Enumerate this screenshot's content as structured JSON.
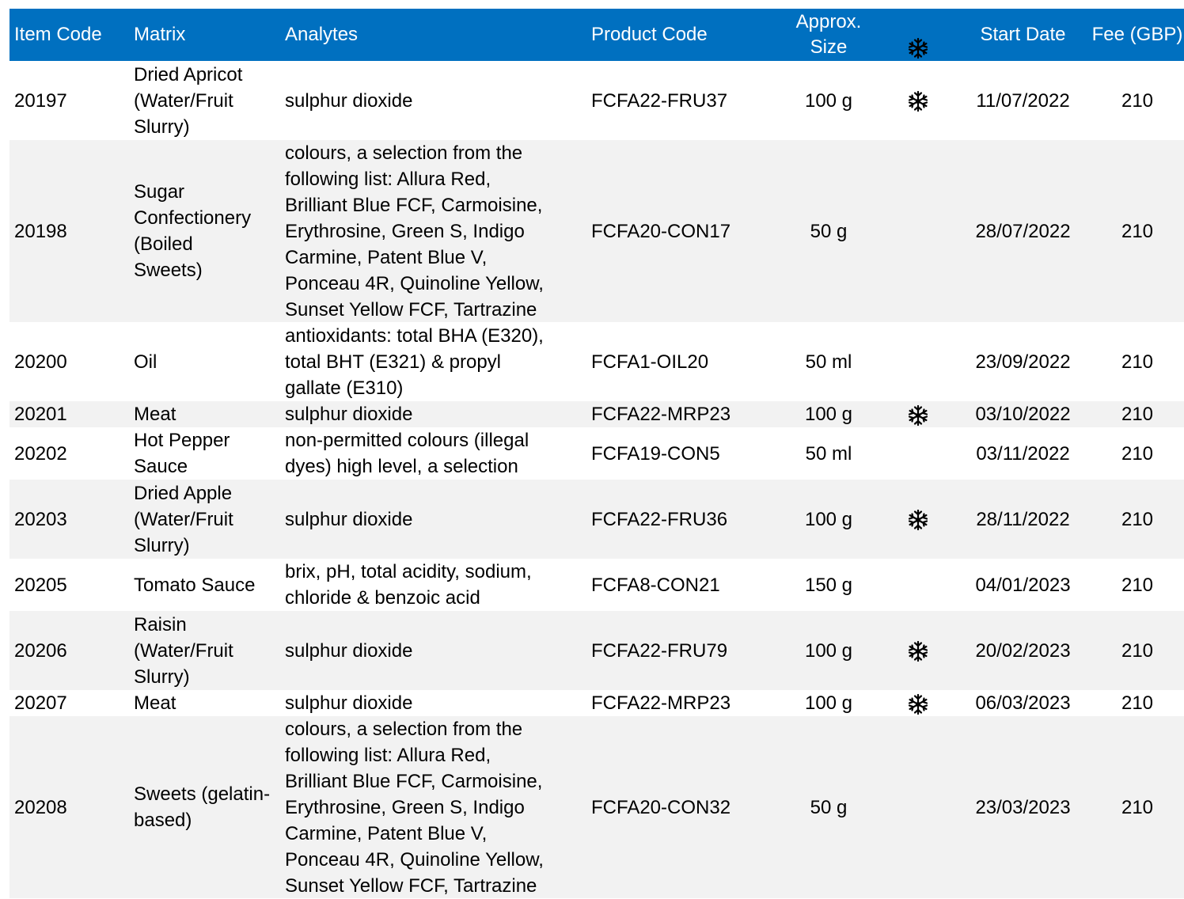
{
  "headers": {
    "item_code": "Item Code",
    "matrix": "Matrix",
    "analytes": "Analytes",
    "product_code": "Product Code",
    "approx_size": "Approx.\nSize",
    "frozen_icon": "snowflake-icon",
    "start_date": "Start Date",
    "fee": "Fee (GBP)"
  },
  "colors": {
    "header_bg": "#0070c0",
    "header_text": "#ffffff",
    "alt_row_bg": "#f2f2f2"
  },
  "rows": [
    {
      "item_code": "20197",
      "matrix": "Dried Apricot\n(Water/Fruit\nSlurry)",
      "analytes": "sulphur dioxide",
      "product_code": "FCFA22-FRU37",
      "size": "100 g",
      "frozen": true,
      "start_date": "11/07/2022",
      "fee": "210"
    },
    {
      "item_code": "20198",
      "matrix": "Sugar\nConfectionery\n(Boiled\nSweets)",
      "analytes": "colours, a selection from the\nfollowing list: Allura Red,\nBrilliant Blue FCF, Carmoisine,\nErythrosine, Green S, Indigo\nCarmine, Patent Blue V,\nPonceau 4R, Quinoline Yellow,\nSunset Yellow FCF, Tartrazine",
      "product_code": "FCFA20-CON17",
      "size": "50 g",
      "frozen": false,
      "start_date": "28/07/2022",
      "fee": "210"
    },
    {
      "item_code": "20200",
      "matrix": "Oil",
      "analytes": "antioxidants: total BHA (E320),\ntotal BHT (E321) & propyl\ngallate (E310)",
      "product_code": "FCFA1-OIL20",
      "size": "50 ml",
      "frozen": false,
      "start_date": "23/09/2022",
      "fee": "210"
    },
    {
      "item_code": "20201",
      "matrix": "Meat",
      "analytes": "sulphur dioxide",
      "product_code": "FCFA22-MRP23",
      "size": "100 g",
      "frozen": true,
      "start_date": "03/10/2022",
      "fee": "210"
    },
    {
      "item_code": "20202",
      "matrix": "Hot Pepper\nSauce",
      "analytes": "non-permitted colours (illegal\ndyes) high level, a selection",
      "product_code": "FCFA19-CON5",
      "size": "50 ml",
      "frozen": false,
      "start_date": "03/11/2022",
      "fee": "210"
    },
    {
      "item_code": "20203",
      "matrix": "Dried Apple\n(Water/Fruit\nSlurry)",
      "analytes": "sulphur dioxide",
      "product_code": "FCFA22-FRU36",
      "size": "100 g",
      "frozen": true,
      "start_date": "28/11/2022",
      "fee": "210"
    },
    {
      "item_code": "20205",
      "matrix": "Tomato Sauce",
      "analytes": "brix, pH, total acidity, sodium,\nchloride & benzoic acid",
      "product_code": "FCFA8-CON21",
      "size": "150 g",
      "frozen": false,
      "start_date": "04/01/2023",
      "fee": "210"
    },
    {
      "item_code": "20206",
      "matrix": "Raisin\n(Water/Fruit\nSlurry)",
      "analytes": "sulphur dioxide",
      "product_code": "FCFA22-FRU79",
      "size": "100 g",
      "frozen": true,
      "start_date": "20/02/2023",
      "fee": "210"
    },
    {
      "item_code": "20207",
      "matrix": "Meat",
      "analytes": "sulphur dioxide",
      "product_code": "FCFA22-MRP23",
      "size": "100 g",
      "frozen": true,
      "start_date": "06/03/2023",
      "fee": "210"
    },
    {
      "item_code": "20208",
      "matrix": "Sweets (gelatin-\nbased)",
      "analytes": "colours, a selection from the\nfollowing list: Allura Red,\nBrilliant Blue FCF, Carmoisine,\nErythrosine, Green S, Indigo\nCarmine, Patent Blue V,\nPonceau 4R, Quinoline Yellow,\nSunset Yellow FCF, Tartrazine",
      "product_code": "FCFA20-CON32",
      "size": "50 g",
      "frozen": false,
      "start_date": "23/03/2023",
      "fee": "210"
    }
  ]
}
